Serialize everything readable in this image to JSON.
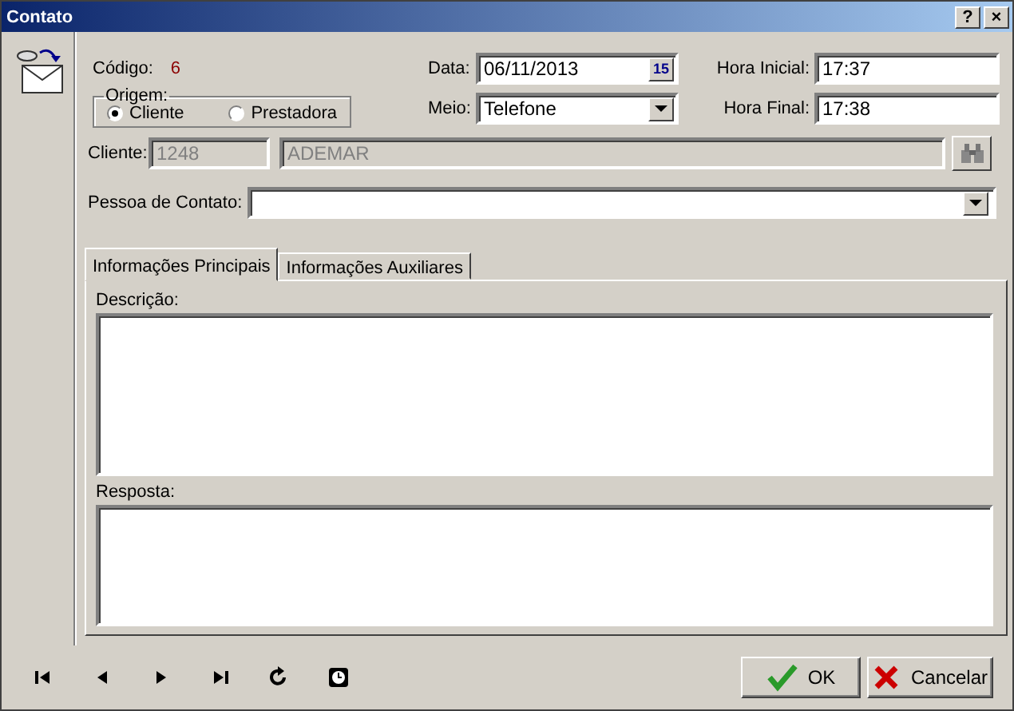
{
  "window": {
    "title": "Contato",
    "help": "?",
    "close": "×"
  },
  "codigo": {
    "label": "Código:",
    "value": "6"
  },
  "origem": {
    "title": "Origem:",
    "options": [
      {
        "label": "Cliente",
        "selected": true
      },
      {
        "label": "Prestadora",
        "selected": false
      }
    ]
  },
  "data": {
    "label": "Data:",
    "value": "06/11/2013",
    "calendar": "15"
  },
  "meio": {
    "label": "Meio:",
    "value": "Telefone"
  },
  "hora_inicial": {
    "label": "Hora Inicial:",
    "value": "17:37"
  },
  "hora_final": {
    "label": "Hora Final:",
    "value": "17:38"
  },
  "cliente": {
    "label": "Cliente:",
    "code": "1248",
    "name": "ADEMAR",
    "disabled": true
  },
  "pessoa_contato": {
    "label": "Pessoa de Contato:"
  },
  "tabs": [
    {
      "label": "Informações Principais",
      "selected": true
    },
    {
      "label": "Informações Auxiliares",
      "selected": false
    }
  ],
  "descricao": {
    "label": "Descrição:"
  },
  "resposta": {
    "label": "Resposta:"
  },
  "buttons": [
    {
      "label": "OK",
      "kind": "ok"
    },
    {
      "label": "Cancelar",
      "kind": "cancel"
    }
  ]
}
